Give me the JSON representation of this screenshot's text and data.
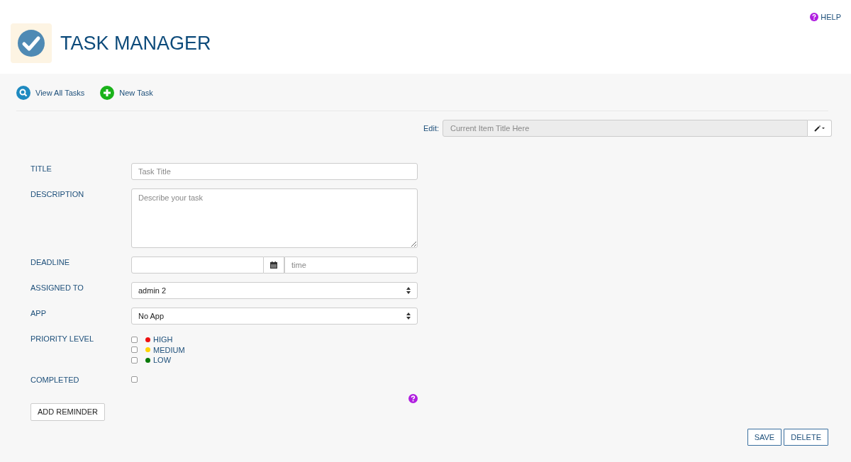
{
  "header": {
    "title": "TASK MANAGER",
    "help": "HELP"
  },
  "nav": [
    {
      "label": "View All Tasks",
      "kind": "search"
    },
    {
      "label": "New Task",
      "kind": "add"
    }
  ],
  "edit": {
    "label": "Edit:",
    "placeholder": "Current Item Title Here"
  },
  "form": {
    "title": {
      "label": "TITLE",
      "placeholder": "Task Title"
    },
    "description": {
      "label": "DESCRIPTION",
      "placeholder": "Describe your task"
    },
    "deadline": {
      "label": "DEADLINE",
      "time_placeholder": "time"
    },
    "assigned_to": {
      "label": "ASSIGNED TO",
      "value": "admin 2"
    },
    "app": {
      "label": "APP",
      "value": "No App"
    },
    "priority": {
      "label": "PRIORITY LEVEL",
      "options": [
        {
          "label": "HIGH",
          "checked": false,
          "color": "#ee1111"
        },
        {
          "label": "MEDIUM",
          "checked": false,
          "color": "#ffd400"
        },
        {
          "label": "LOW",
          "checked": false,
          "color": "#0a7a0a"
        }
      ]
    },
    "completed": {
      "label": "COMPLETED",
      "checked": false
    }
  },
  "buttons": {
    "add_reminder": "ADD REMINDER",
    "save": "SAVE",
    "delete": "DELETE"
  }
}
